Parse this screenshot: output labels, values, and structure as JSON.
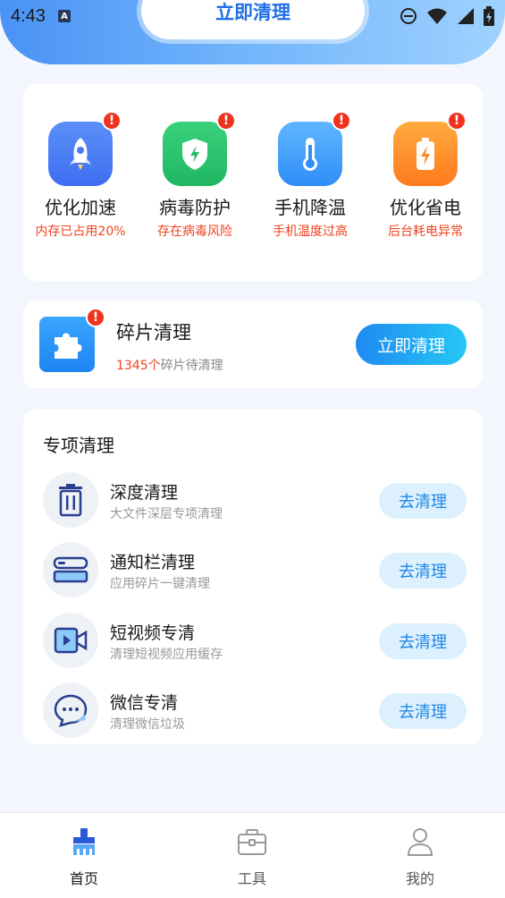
{
  "status_bar": {
    "time": "4:43",
    "notif_glyph": "A"
  },
  "header": {
    "main_button": "立即清理"
  },
  "quick_items": [
    {
      "title": "优化加速",
      "sub": "内存已占用20%",
      "icon": "rocket-icon",
      "badge": "!"
    },
    {
      "title": "病毒防护",
      "sub": "存在病毒风险",
      "icon": "shield-icon",
      "badge": "!"
    },
    {
      "title": "手机降温",
      "sub": "手机温度过高",
      "icon": "thermometer-icon",
      "badge": "!"
    },
    {
      "title": "优化省电",
      "sub": "后台耗电异常",
      "icon": "battery-icon",
      "badge": "!"
    }
  ],
  "fragment": {
    "title": "碎片清理",
    "count": "1345个",
    "sub_suffix": "碎片待清理",
    "button": "立即清理",
    "badge": "!",
    "icon": "puzzle-icon"
  },
  "special": {
    "title": "专项清理",
    "items": [
      {
        "name": "深度清理",
        "desc": "大文件深层专项清理",
        "button": "去清理",
        "icon": "trash-icon"
      },
      {
        "name": "通知栏清理",
        "desc": "应用碎片一键清理",
        "button": "去清理",
        "icon": "notification-bar-icon"
      },
      {
        "name": "短视频专清",
        "desc": "清理短视频应用缓存",
        "button": "去清理",
        "icon": "video-icon"
      },
      {
        "name": "微信专清",
        "desc": "清理微信垃圾",
        "button": "去清理",
        "icon": "chat-icon"
      }
    ]
  },
  "nav": [
    {
      "label": "首页",
      "icon": "broom-icon",
      "active": true
    },
    {
      "label": "工具",
      "icon": "toolbox-icon",
      "active": false
    },
    {
      "label": "我的",
      "icon": "user-icon",
      "active": false
    }
  ],
  "colors": {
    "accent": "#1f87e8",
    "warning": "#f0421f"
  }
}
